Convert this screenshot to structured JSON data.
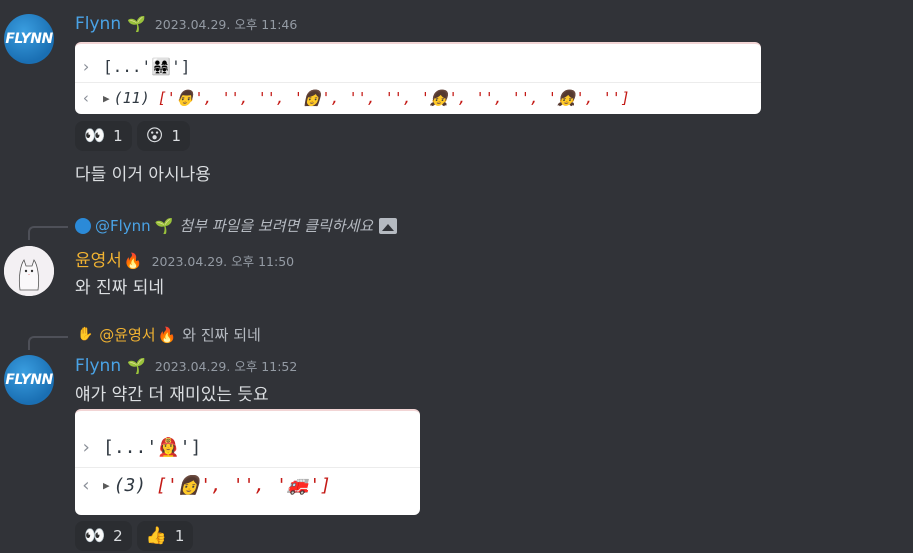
{
  "messages": [
    {
      "avatar_text": "FLYNN",
      "username": "Flynn",
      "badge": "🌱",
      "timestamp": "2023.04.29. 오후 11:46",
      "console": {
        "input_prefix": "[...'",
        "input_emoji": "👨‍👩‍👧‍👧",
        "input_suffix": "']",
        "output_count": "(11)",
        "output_items": [
          "'🧑",
          "'",
          ", ",
          "'\u0000'",
          ", ",
          "''",
          ", ",
          "'👩",
          "'",
          ", ",
          "'\u0000'",
          ", ",
          "''",
          ", ",
          "'👧",
          "'",
          ", ",
          "'\u0000'",
          ", ",
          "''",
          ", ",
          "'👧",
          "'",
          ", ",
          "'\u0000'"
        ],
        "output_text": "['👨', '‍', '', '👩', '‍', '', '👧', '‍', '', '👧', '‍']"
      },
      "reactions": [
        {
          "emoji": "👀",
          "count": "1"
        },
        {
          "emoji": "😮",
          "count": "1"
        }
      ],
      "text": "다들 이거 아시나용"
    },
    {
      "reply": {
        "user": "@Flynn",
        "badge": "🌱",
        "text": "첨부 파일을 보려면 클릭하세요"
      },
      "username": "윤영서",
      "badge": "🔥",
      "timestamp": "2023.04.29. 오후 11:50",
      "text": "와 진짜 되네"
    },
    {
      "reply": {
        "user": "@윤영서",
        "badge": "🔥",
        "text": "와 진짜 되네"
      },
      "avatar_text": "FLYNN",
      "username": "Flynn",
      "badge": "🌱",
      "timestamp": "2023.04.29. 오후 11:52",
      "text": "얘가 약간 더 재미있는 듯요",
      "console": {
        "input_prefix": "[...'",
        "input_emoji": "👩‍🚒",
        "input_suffix": "']",
        "output_count": "(3)",
        "output_text": "['👩', '', '🚒']"
      },
      "reactions": [
        {
          "emoji": "👀",
          "count": "2"
        },
        {
          "emoji": "👍",
          "count": "1"
        }
      ]
    }
  ]
}
